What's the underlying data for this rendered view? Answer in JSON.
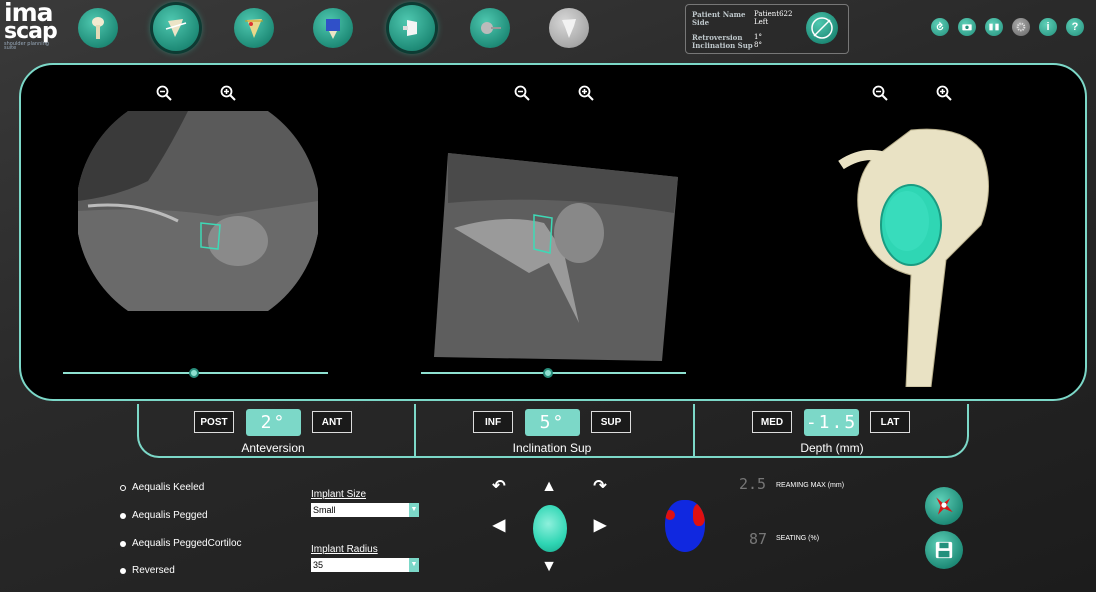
{
  "logo": {
    "line1": "ima",
    "line2": "scap",
    "tagline": "shoulder planning suite"
  },
  "steps": [
    {
      "name": "humerus-step",
      "state": "normal"
    },
    {
      "name": "glenoid-axis-step",
      "state": "active"
    },
    {
      "name": "scapula-landmarks-step",
      "state": "normal"
    },
    {
      "name": "implant-select-step",
      "state": "normal"
    },
    {
      "name": "glenoid-implant-step",
      "state": "active"
    },
    {
      "name": "reaming-step",
      "state": "normal"
    },
    {
      "name": "final-review-step",
      "state": "disabled"
    }
  ],
  "patient": {
    "name_label": "Patient Name",
    "name_value": "Patient622",
    "side_label": "Side",
    "side_value": "Left",
    "retro_label": "Retroversion",
    "retro_value": "1°",
    "incl_label": "Inclination Sup",
    "incl_value": "8°"
  },
  "toolbar": {
    "info": "i",
    "help": "?"
  },
  "controls": {
    "anteversion": {
      "left_btn": "POST",
      "value": "2°",
      "right_btn": "ANT",
      "label": "Anteversion"
    },
    "inclination": {
      "left_btn": "INF",
      "value": "5°",
      "right_btn": "SUP",
      "label": "Inclination Sup"
    },
    "depth": {
      "left_btn": "MED",
      "value": "-1.5",
      "right_btn": "LAT",
      "label": "Depth (mm)"
    }
  },
  "implants": [
    {
      "label": "Aequalis Keeled",
      "selected": true
    },
    {
      "label": "Aequalis Pegged",
      "selected": false
    },
    {
      "label": "Aequalis PeggedCortiloc",
      "selected": false
    },
    {
      "label": "Reversed",
      "selected": false
    }
  ],
  "implant_size": {
    "label": "Implant Size",
    "value": "Small"
  },
  "implant_radius": {
    "label": "Implant Radius",
    "value": "35"
  },
  "reaming": {
    "value": "2.5",
    "label": "REAMING MAX (mm)"
  },
  "seating": {
    "value": "87",
    "label": "SEATING (%)"
  },
  "colors": {
    "accent": "#7cd8c8",
    "implant": "#2fd6b4",
    "bone": "#e9e2c4"
  }
}
